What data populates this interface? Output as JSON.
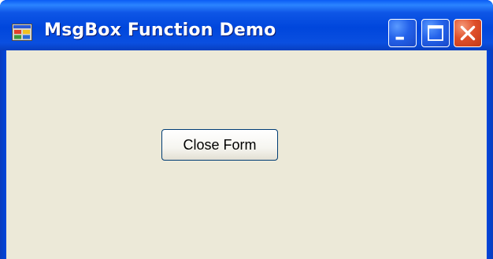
{
  "window": {
    "title": "MsgBox Function Demo",
    "icon": "app-icon",
    "controls": {
      "minimize_icon": "minimize-icon",
      "maximize_icon": "maximize-icon",
      "close_icon": "close-icon"
    }
  },
  "form": {
    "button_label": "Close Form"
  },
  "colors": {
    "titlebar": "#0046dc",
    "client_background": "#ece9d8",
    "close_button": "#e0502b",
    "button_border": "#003c74"
  }
}
